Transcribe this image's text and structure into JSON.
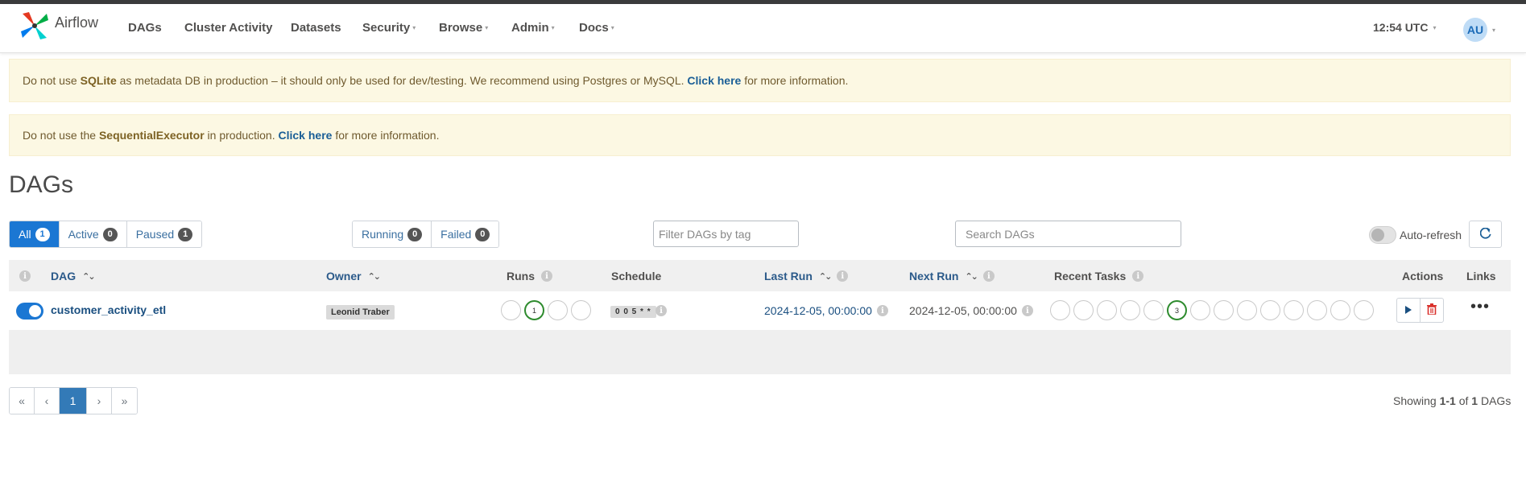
{
  "app": {
    "name": "Airflow"
  },
  "nav": {
    "items": [
      {
        "label": "DAGs"
      },
      {
        "label": "Cluster Activity"
      },
      {
        "label": "Datasets"
      },
      {
        "label": "Security"
      },
      {
        "label": "Browse"
      },
      {
        "label": "Admin"
      },
      {
        "label": "Docs"
      }
    ],
    "clock": "12:54 UTC",
    "user_initials": "AU"
  },
  "alerts": [
    {
      "pre": "Do not use ",
      "bold": "SQLite",
      "mid": " as metadata DB in production – it should only be used for dev/testing. We recommend using Postgres or MySQL. ",
      "link": "Click here",
      "post": " for more information."
    },
    {
      "pre": "Do not use the ",
      "bold": "SequentialExecutor",
      "mid": " in production. ",
      "link": "Click here",
      "post": " for more information."
    }
  ],
  "page_title": "DAGs",
  "status_filter": {
    "all": {
      "label": "All",
      "count": "1"
    },
    "active": {
      "label": "Active",
      "count": "0"
    },
    "paused": {
      "label": "Paused",
      "count": "1"
    }
  },
  "run_filter": {
    "running": {
      "label": "Running",
      "count": "0"
    },
    "failed": {
      "label": "Failed",
      "count": "0"
    }
  },
  "tag_filter": {
    "placeholder": "Filter DAGs by tag"
  },
  "search": {
    "placeholder": "Search DAGs"
  },
  "auto_refresh": {
    "label": "Auto-refresh",
    "enabled": false
  },
  "columns": {
    "dag": "DAG",
    "owner": "Owner",
    "runs": "Runs",
    "schedule": "Schedule",
    "last_run": "Last Run",
    "next_run": "Next Run",
    "recent_tasks": "Recent Tasks",
    "actions": "Actions",
    "links": "Links"
  },
  "dags": [
    {
      "dag_id": "customer_activity_etl",
      "active": true,
      "owner": "Leonid Traber",
      "runs": [
        "",
        "1",
        "",
        ""
      ],
      "schedule": "0 0 5 * *",
      "last_run": "2024-12-05, 00:00:00",
      "next_run": "2024-12-05, 00:00:00",
      "recent_tasks": [
        "",
        "",
        "",
        "",
        "",
        "3",
        "",
        "",
        "",
        "",
        "",
        "",
        "",
        ""
      ]
    }
  ],
  "pagination": {
    "first": "«",
    "prev": "‹",
    "current": "1",
    "next": "›",
    "last": "»"
  },
  "showing": {
    "prefix": "Showing ",
    "range": "1-1",
    "of": " of ",
    "total": "1",
    "suffix": " DAGs"
  },
  "colors": {
    "primary": "#1b77d3",
    "success": "#2e8b2e",
    "alert_bg": "#fcf8e3"
  }
}
